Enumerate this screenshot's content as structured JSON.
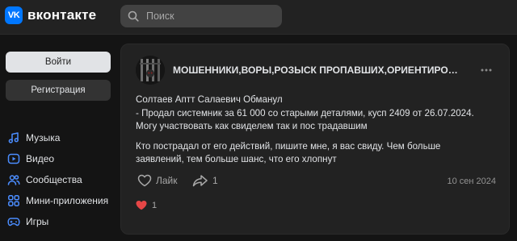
{
  "header": {
    "logo_mark": "VK",
    "logo_text": "вконтакте",
    "search_placeholder": "Поиск"
  },
  "auth": {
    "login_label": "Войти",
    "register_label": "Регистрация"
  },
  "nav": [
    {
      "label": "Музыка",
      "icon": "music-icon"
    },
    {
      "label": "Видео",
      "icon": "video-icon"
    },
    {
      "label": "Сообщества",
      "icon": "communities-icon"
    },
    {
      "label": "Мини-приложения",
      "icon": "mini-apps-icon"
    },
    {
      "label": "Игры",
      "icon": "games-icon"
    }
  ],
  "post": {
    "group_name": "МОШЕННИКИ,ВОРЫ,РОЗЫСК ПРОПАВШИХ,ОРИЕНТИРОВК...",
    "paragraph1": [
      "Солтаев Аптт Салаевич Обманул",
      "- Продал системник за 61 000 со старыми деталями, кусп 2409 от 26.07.2024.",
      "Могу участвовать как свиделем так и пос традавшим"
    ],
    "paragraph2": [
      "Кто пострадал от его действий, пишите мне, я вас свиду. Чем больше",
      "заявлений, тем больше шанс, что его хлопнут"
    ],
    "like_label": "Лайк",
    "share_count": "1",
    "date": "10 сен 2024",
    "reaction_count": "1"
  },
  "colors": {
    "accent": "#0077ff",
    "background": "#141414",
    "card": "#222222",
    "reaction": "#e64646"
  }
}
